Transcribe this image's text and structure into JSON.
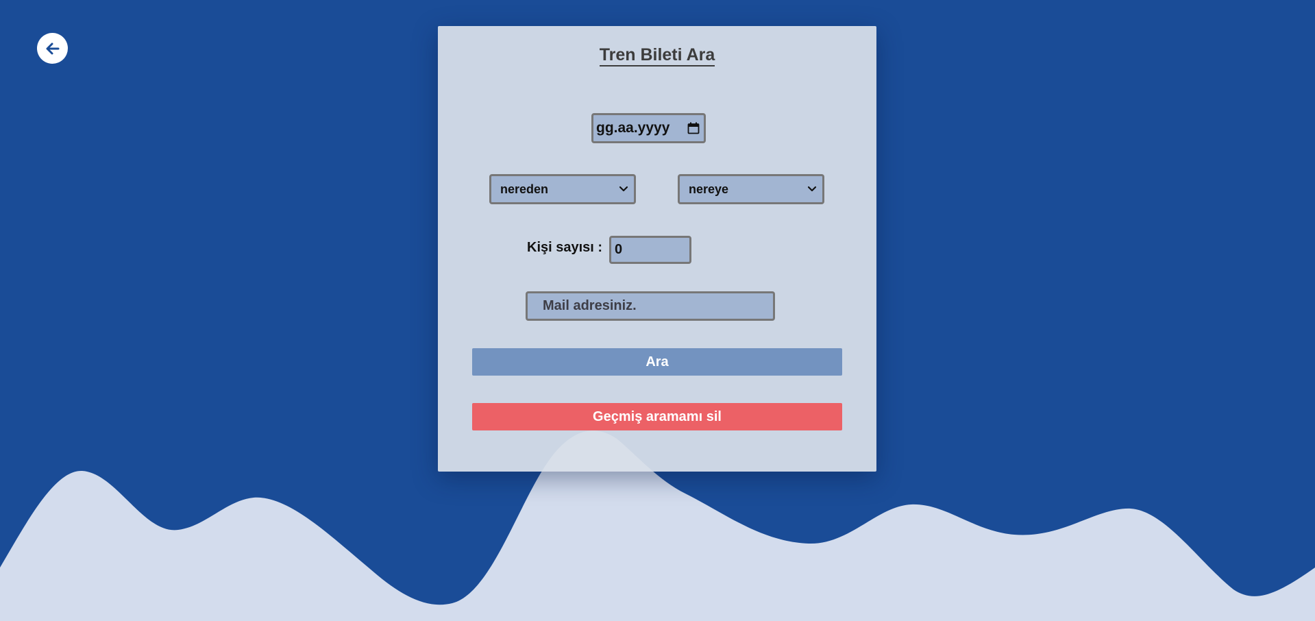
{
  "page": {
    "title": "Tren Bileti Ara"
  },
  "colors": {
    "background": "#1a4c97",
    "wave": "#d3dced",
    "card": "#d8dfe9",
    "field": "#a2b5d2",
    "search_button": "#7393c0",
    "clear_button": "#ec6166"
  },
  "back_button": {
    "icon": "arrow-left-icon"
  },
  "form": {
    "date": {
      "placeholder": "gg.aa.yyyy",
      "icon": "calendar-icon"
    },
    "from": {
      "selected": "nereden",
      "icon": "chevron-down-icon"
    },
    "to": {
      "selected": "nereye",
      "icon": "chevron-down-icon"
    },
    "passenger_count": {
      "label": "Kişi sayısı :",
      "value": "0"
    },
    "email": {
      "placeholder": "Mail adresiniz."
    },
    "search_label": "Ara",
    "clear_history_label": "Geçmiş aramamı sil"
  }
}
